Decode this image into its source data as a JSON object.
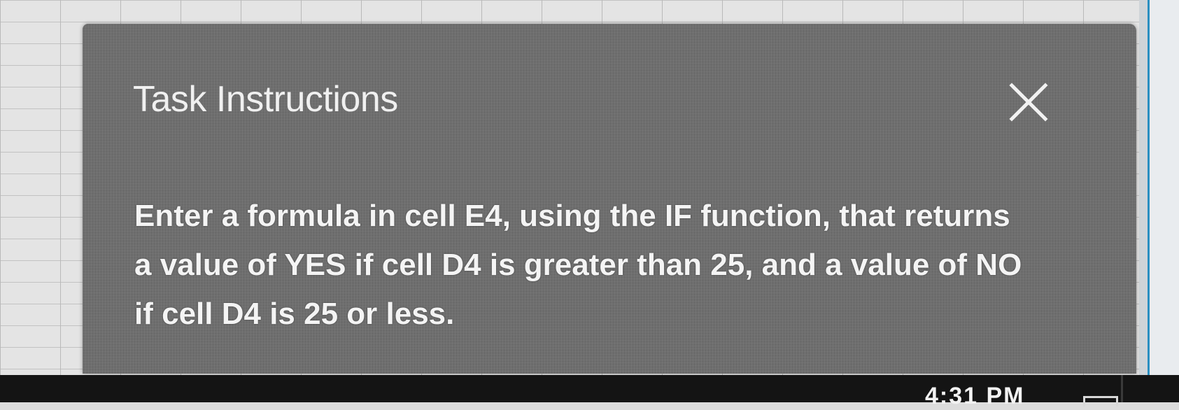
{
  "dialog": {
    "title": "Task Instructions",
    "close_icon": "close-icon",
    "instructions": "Enter a formula in cell E4, using the IF function, that returns a value of YES if cell D4 is greater than 25, and a value of NO if cell D4 is 25 or less."
  },
  "taskbar": {
    "clock": "4:31 PM"
  },
  "colors": {
    "dialog_background": "#6b6b6b",
    "text": "#f0f0f0",
    "taskbar": "#141414",
    "accent_edge": "#2a8fc1"
  }
}
